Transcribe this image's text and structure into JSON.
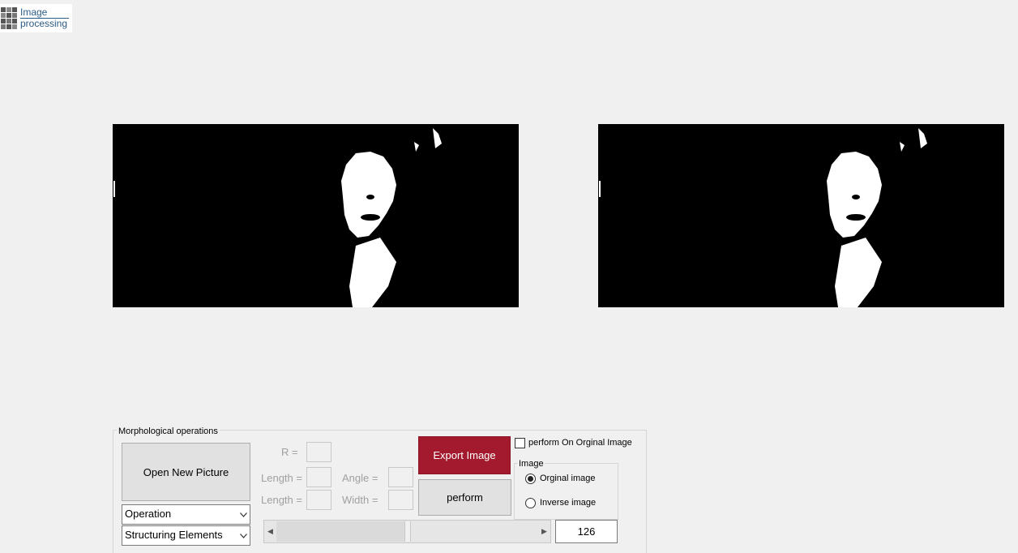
{
  "logo": {
    "line1": "Image",
    "line2": "processing"
  },
  "images": {
    "left": "original-image-panel",
    "right": "processed-image-panel"
  },
  "morph": {
    "title": "Morphological operations",
    "open_label": "Open New Picture",
    "export_label": "Export Image",
    "perform_label": "perform",
    "operation_value": "Operation",
    "structuring_value": "Structuring Elements",
    "r_label": "R =",
    "length_label": "Length =",
    "angle_label": "Angle =",
    "width_label": "Width =",
    "checkbox_label": "perform On Orginal Image",
    "checkbox_checked": false,
    "image_group_title": "Image",
    "radio_original": "Orginal image",
    "radio_inverse": "Inverse image",
    "radio_selected": "original",
    "slider_value": "126",
    "slider_max": 255,
    "colors": {
      "export_bg": "#a31a2e"
    }
  }
}
